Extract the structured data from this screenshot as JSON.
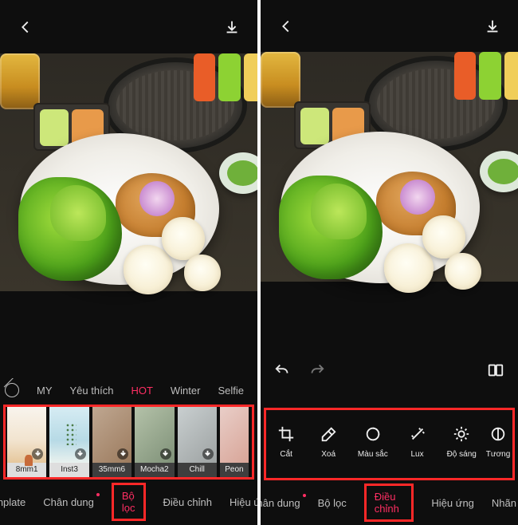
{
  "colors": {
    "accent": "#ff2e63",
    "highlight_box": "#ff2828"
  },
  "left": {
    "categories": [
      "MY",
      "Yêu thích",
      "HOT",
      "Winter",
      "Selfie"
    ],
    "active_category_index": 2,
    "filters": [
      {
        "name": "8mm1",
        "style": "light"
      },
      {
        "name": "Inst3",
        "style": "light"
      },
      {
        "name": "35mm6",
        "style": "dark"
      },
      {
        "name": "Mocha2",
        "style": "dark"
      },
      {
        "name": "Chill",
        "style": "dark"
      },
      {
        "name": "Peon",
        "style": "dark"
      }
    ],
    "tabs": [
      "emplate",
      "Chân dung",
      "Bộ lọc",
      "Điều chỉnh",
      "Hiệu ứ"
    ],
    "active_tab_index": 2
  },
  "right": {
    "adjust_icons": [
      {
        "label": "Cắt",
        "icon": "crop-icon"
      },
      {
        "label": "Xoá",
        "icon": "eraser-icon"
      },
      {
        "label": "Màu sắc",
        "icon": "color-icon"
      },
      {
        "label": "Lux",
        "icon": "wand-icon"
      },
      {
        "label": "Độ sáng",
        "icon": "brightness-icon"
      },
      {
        "label": "Tương",
        "icon": "half-circle-icon"
      }
    ],
    "tabs": [
      "Chân dung",
      "Bộ lọc",
      "Điều chỉnh",
      "Hiệu ứng",
      "Nhãn"
    ],
    "active_tab_index": 2
  }
}
